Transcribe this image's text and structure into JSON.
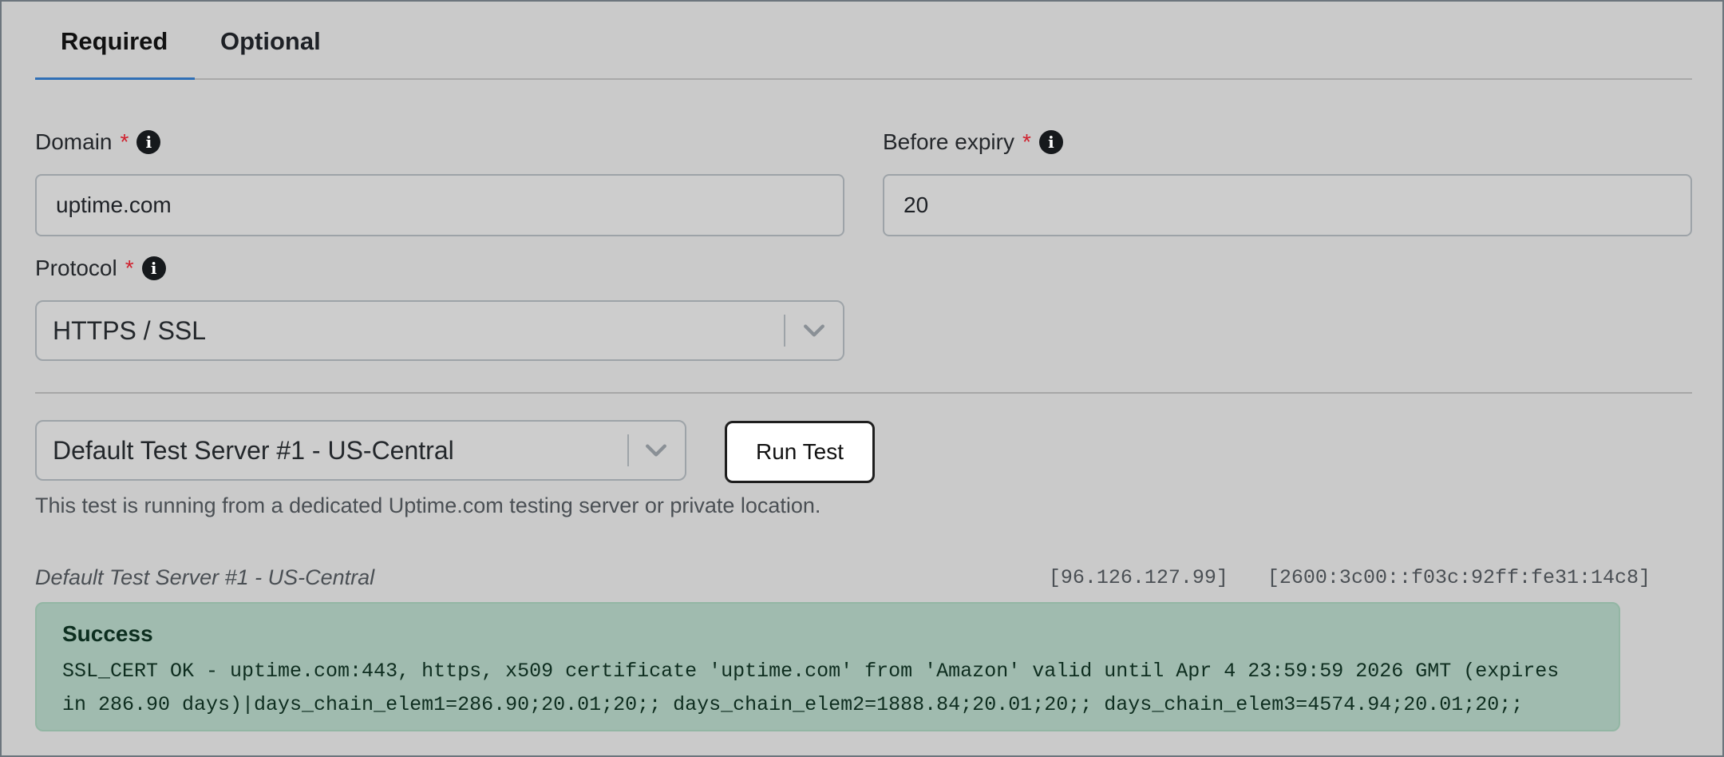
{
  "tabs": [
    {
      "label": "Required",
      "active": true
    },
    {
      "label": "Optional",
      "active": false
    }
  ],
  "form": {
    "domain": {
      "label": "Domain",
      "required_mark": "*",
      "value": "uptime.com"
    },
    "before_expiry": {
      "label": "Before expiry",
      "required_mark": "*",
      "value": "20"
    },
    "protocol": {
      "label": "Protocol",
      "required_mark": "*",
      "selected": "HTTPS / SSL"
    }
  },
  "test": {
    "server_selected": "Default Test Server #1 - US-Central",
    "run_button_label": "Run Test",
    "help_text": "This test is running from a dedicated Uptime.com testing server or private location."
  },
  "result": {
    "server_name": "Default Test Server #1 - US-Central",
    "ipv4": "[96.126.127.99]",
    "ipv6": "[2600:3c00::f03c:92ff:fe31:14c8]",
    "status": "Success",
    "message": "SSL_CERT OK - uptime.com:443, https, x509 certificate 'uptime.com' from 'Amazon' valid until Apr 4 23:59:59 2026 GMT (expires in 286.90 days)|days_chain_elem1=286.90;20.01;20;; days_chain_elem2=1888.84;20.01;20;; days_chain_elem3=4574.94;20.01;20;;"
  },
  "icons": {
    "info": "info-circle-icon",
    "chevron": "chevron-down-icon"
  },
  "colors": {
    "tab_active_underline": "#2f6fb6",
    "required_mark": "#d0212e",
    "success_bg": "#a0bbaf"
  }
}
